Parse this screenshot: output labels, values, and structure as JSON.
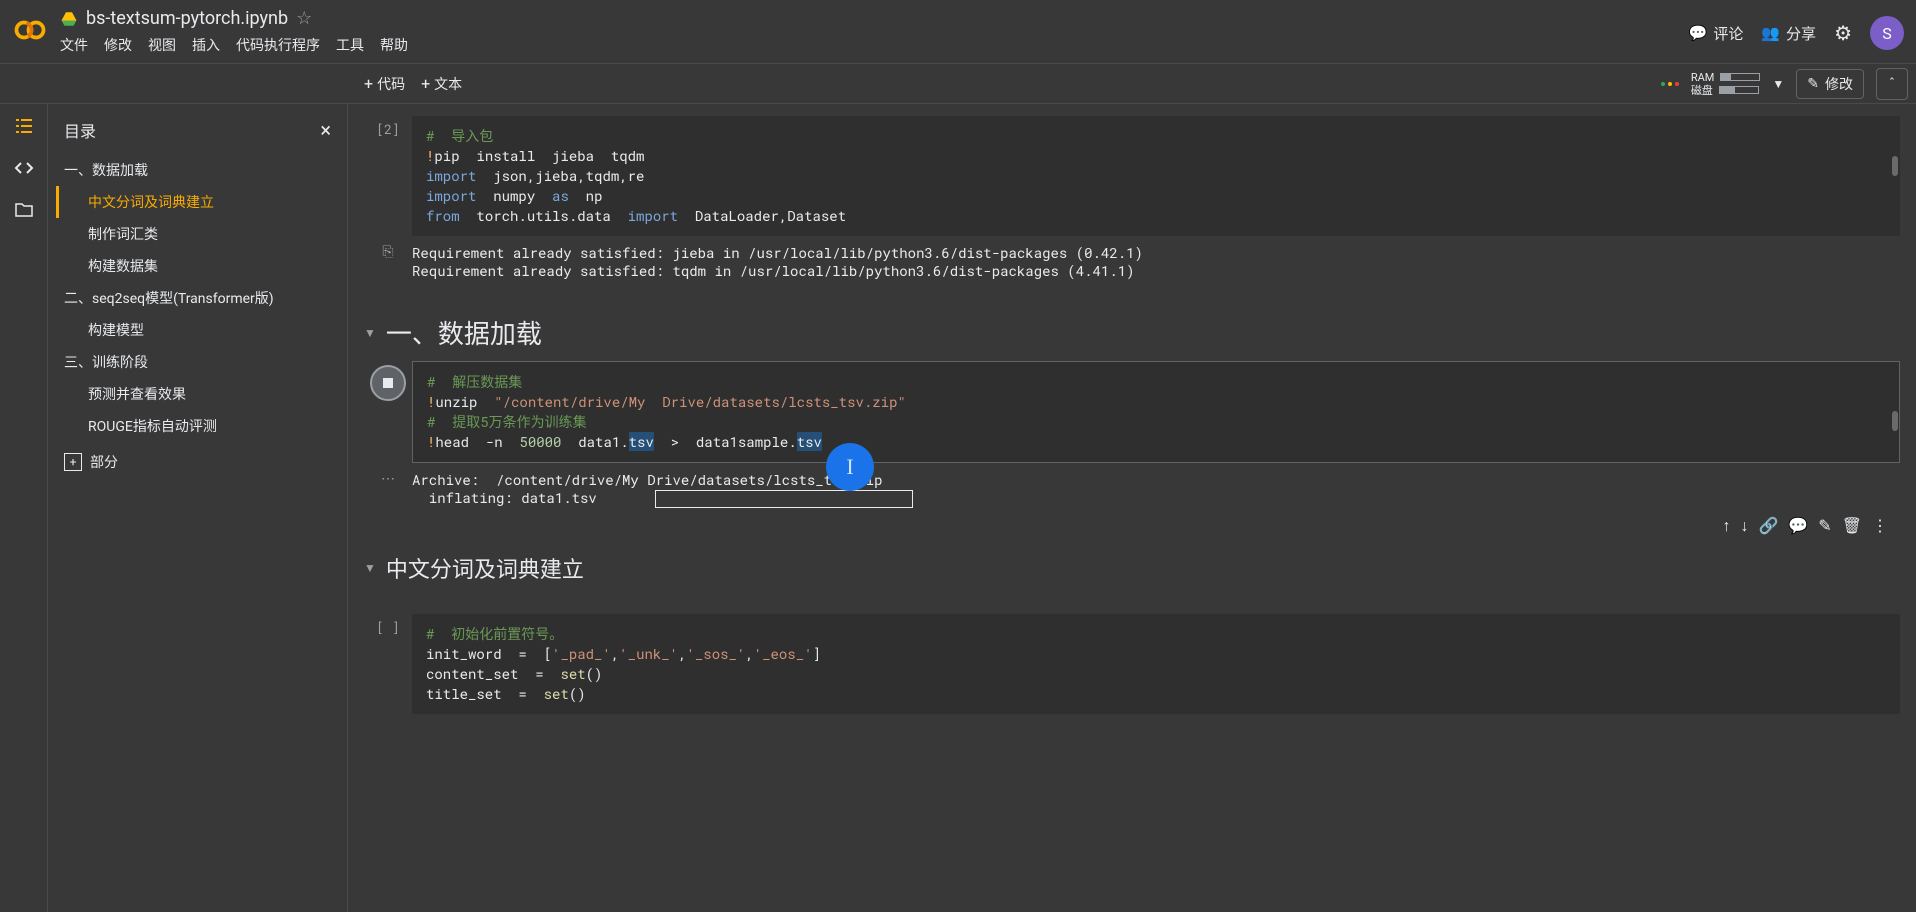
{
  "header": {
    "notebook_title": "bs-textsum-pytorch.ipynb",
    "menus": [
      "文件",
      "修改",
      "视图",
      "插入",
      "代码执行程序",
      "工具",
      "帮助"
    ],
    "comment_label": "评论",
    "share_label": "分享",
    "avatar_letter": "S"
  },
  "toolbar": {
    "code_label": "代码",
    "text_label": "文本",
    "ram_label": "RAM",
    "disk_label": "磁盘",
    "edit_label": "修改"
  },
  "sidebar": {
    "title": "目录",
    "items": [
      {
        "label": "一、数据加载",
        "level": 1,
        "active": false
      },
      {
        "label": "中文分词及词典建立",
        "level": 2,
        "active": true
      },
      {
        "label": "制作词汇类",
        "level": 2,
        "active": false
      },
      {
        "label": "构建数据集",
        "level": 2,
        "active": false
      },
      {
        "label": "二、seq2seq模型(Transformer版)",
        "level": 1,
        "active": false
      },
      {
        "label": "构建模型",
        "level": 2,
        "active": false
      },
      {
        "label": "三、训练阶段",
        "level": 1,
        "active": false
      },
      {
        "label": "预测并查看效果",
        "level": 2,
        "active": false
      },
      {
        "label": "ROUGE指标自动评测",
        "level": 2,
        "active": false
      }
    ],
    "add_section": "部分"
  },
  "cells": {
    "cell1": {
      "exec": "[2]",
      "code": {
        "l1_comment": "#  导入包",
        "l2_magic": "!",
        "l2_rest": "pip  install  jieba  tqdm",
        "l3_kw": "import",
        "l3_rest": "  json,jieba,tqdm,re",
        "l4_kw": "import",
        "l4_mid": "  numpy  ",
        "l4_as": "as",
        "l4_np": "  np",
        "l5_from": "from",
        "l5_mod": "  torch.utils.data  ",
        "l5_imp": "import",
        "l5_rest": "  DataLoader,Dataset"
      },
      "output": "Requirement already satisfied: jieba in /usr/local/lib/python3.6/dist-packages (0.42.1)\nRequirement already satisfied: tqdm in /usr/local/lib/python3.6/dist-packages (4.41.1)"
    },
    "heading1": "一、数据加载",
    "cell2": {
      "code": {
        "l1_comment": "#  解压数据集",
        "l2_magic": "!",
        "l2_cmd": "unzip  ",
        "l2_path": "\"/content/drive/My  Drive/datasets/lcsts_tsv.zip\"",
        "l3_comment": "#  提取5万条作为训练集",
        "l4_magic": "!",
        "l4_a": "head  -n  ",
        "l4_num": "50000",
        "l4_b": "  data1.",
        "l4_sel1": "tsv",
        "l4_c": "  ",
        "l4_op": ">",
        "l4_d": "  data1sample.",
        "l4_sel2": "tsv"
      },
      "output_line1": "Archive:  /content/drive/My Drive/datasets/lcsts_tsv.zip",
      "output_line2": "  inflating: data1.tsv"
    },
    "heading2": "中文分词及词典建立",
    "cell3": {
      "exec": "[ ]",
      "code": {
        "l1_comment": "#  初始化前置符号。",
        "l2_a": "init_word  ",
        "l2_eq": "=",
        "l2_b": "  [",
        "l2_s1": "'_pad_'",
        "l2_c": ",",
        "l2_s2": "'_unk_'",
        "l2_d": ",",
        "l2_s3": "'_sos_'",
        "l2_e": ",",
        "l2_s4": "'_eos_'",
        "l2_f": "]",
        "l3_a": "content_set  ",
        "l3_eq": "=",
        "l3_b": "  ",
        "l3_fn": "set",
        "l3_c": "()",
        "l4_a": "title_set  ",
        "l4_eq": "=",
        "l4_b": "  ",
        "l4_fn": "set",
        "l4_c": "()"
      }
    }
  },
  "cell_toolbar_icons": [
    "up",
    "down",
    "link",
    "comment",
    "edit",
    "delete",
    "more"
  ]
}
